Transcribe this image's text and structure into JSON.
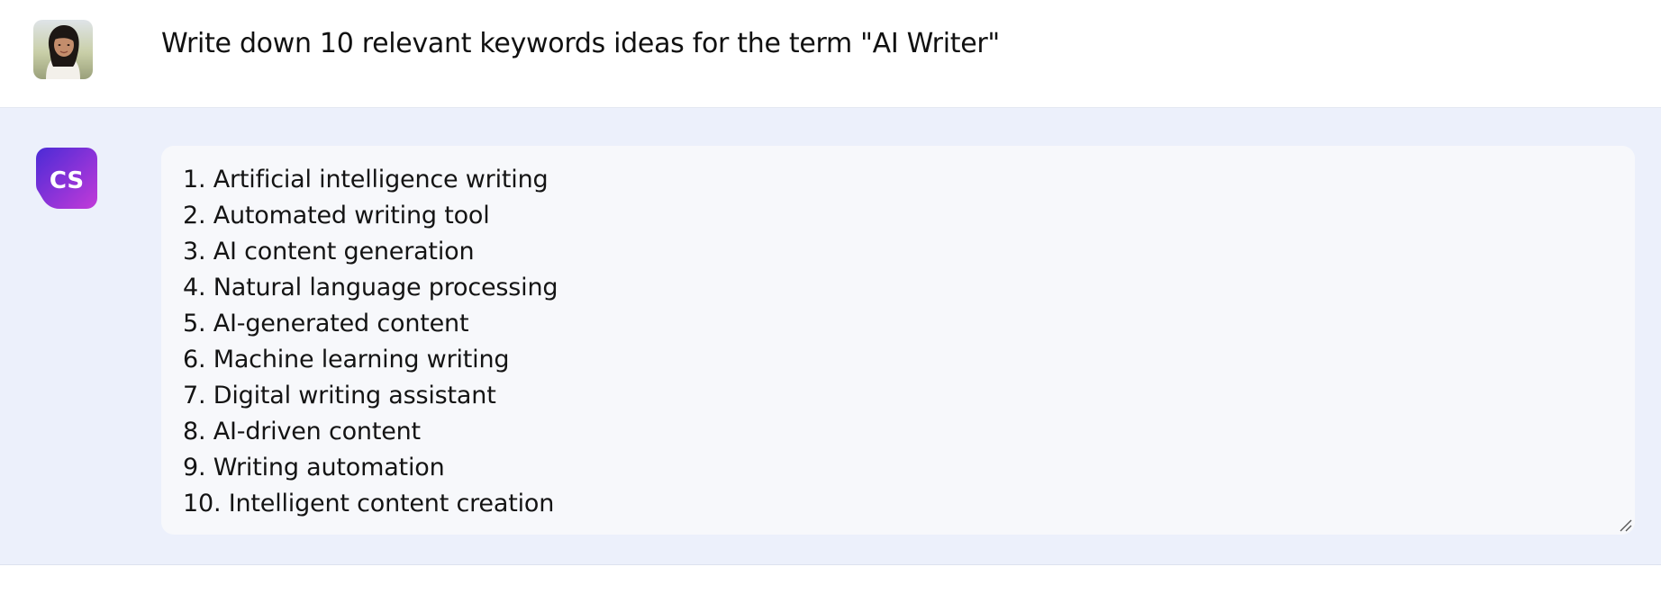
{
  "user_message": {
    "avatar_icon": "user-photo-avatar",
    "text": "Write down 10 relevant keywords ideas for the term \"AI Writer\""
  },
  "assistant_message": {
    "avatar_icon": "copysmith-cs-logo",
    "avatar_text": "CS",
    "lines": [
      "1. Artificial intelligence writing",
      "2. Automated writing tool",
      "3. AI content generation",
      "4. Natural language processing",
      "5. AI-generated content",
      "6. Machine learning writing",
      "7. Digital writing assistant",
      "8. AI-driven content",
      "9. Writing automation",
      "10. Intelligent content creation"
    ]
  },
  "colors": {
    "user_row_bg": "#ffffff",
    "assistant_row_bg": "#ecf0fb",
    "response_box_bg": "#f7f8fb",
    "logo_gradient_start": "#4b2bd6",
    "logo_gradient_end": "#c23ad9"
  }
}
